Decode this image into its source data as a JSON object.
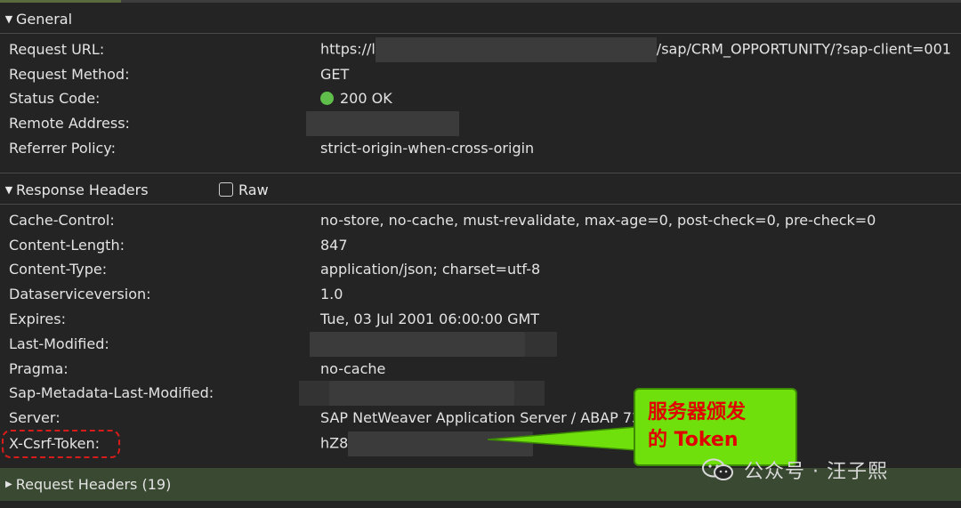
{
  "general": {
    "title": "General",
    "request_url_label": "Request URL:",
    "request_url_prefix": "https://l",
    "request_url_suffix": "/sap/CRM_OPPORTUNITY/?sap-client=001",
    "request_method_label": "Request Method:",
    "request_method_value": "GET",
    "status_code_label": "Status Code:",
    "status_code_value": "200 OK",
    "remote_address_label": "Remote Address:",
    "referrer_policy_label": "Referrer Policy:",
    "referrer_policy_value": "strict-origin-when-cross-origin"
  },
  "response_headers": {
    "title": "Response Headers",
    "raw_label": "Raw",
    "rows": [
      {
        "key": "Cache-Control:",
        "value": "no-store, no-cache, must-revalidate, max-age=0, post-check=0, pre-check=0"
      },
      {
        "key": "Content-Length:",
        "value": "847"
      },
      {
        "key": "Content-Type:",
        "value": "application/json; charset=utf-8"
      },
      {
        "key": "Dataserviceversion:",
        "value": "1.0"
      },
      {
        "key": "Expires:",
        "value": "Tue, 03 Jul 2001 06:00:00 GMT"
      },
      {
        "key": "Last-Modified:",
        "value": ""
      },
      {
        "key": "Pragma:",
        "value": "no-cache"
      },
      {
        "key": "Sap-Metadata-Last-Modified:",
        "value": ""
      },
      {
        "key": "Server:",
        "value": "SAP NetWeaver Application Server / ABAP 731"
      },
      {
        "key": "X-Csrf-Token:",
        "value": "hZ8"
      }
    ]
  },
  "request_headers": {
    "title": "Request Headers (19)"
  },
  "callout": {
    "line1": "服务器颁发",
    "line2": "的 Token"
  },
  "watermark": {
    "text": "公众号 · 汪子熙"
  },
  "colors": {
    "callout_bg": "#6fe00c",
    "callout_text": "#e00000",
    "status_ok": "#5fbf4a",
    "highlight_border": "#d81c1c"
  }
}
